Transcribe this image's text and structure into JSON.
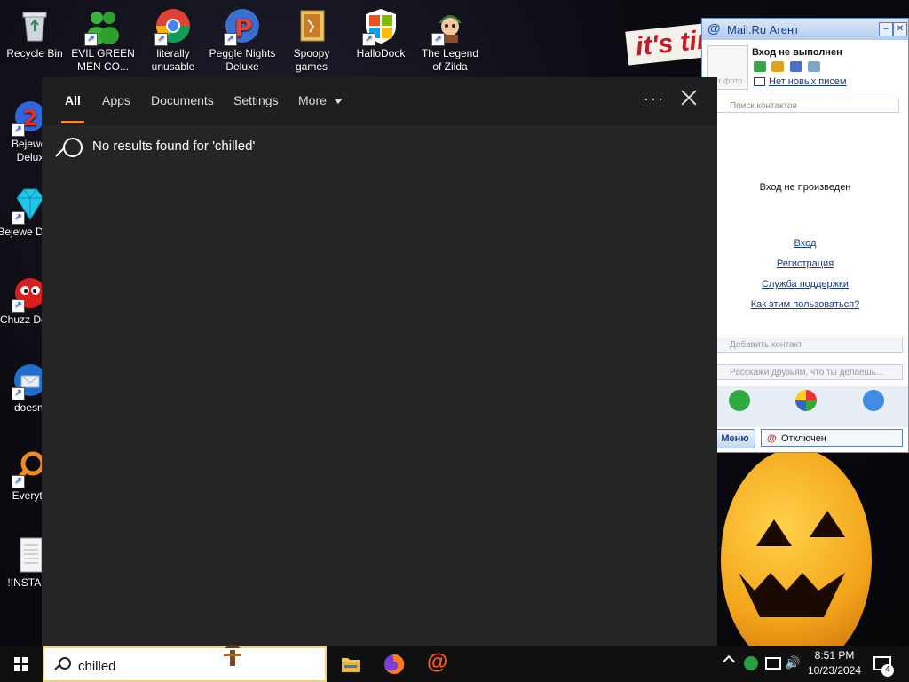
{
  "desktop": {
    "icons": [
      {
        "label": "Recycle Bin"
      },
      {
        "label": "EVIL GREEN MEN CO..."
      },
      {
        "label": "literally unusable"
      },
      {
        "label": "Peggle Nights Deluxe"
      },
      {
        "label": "Spoopy games"
      },
      {
        "label": "HalloDock"
      },
      {
        "label": "The Legend of Zilda"
      },
      {
        "label": "Bejewel Delux"
      },
      {
        "label": "Bejewe Delux"
      },
      {
        "label": "Chuzz Delux"
      },
      {
        "label": "doesnt"
      },
      {
        "label": "Everyth"
      },
      {
        "label": "!INSTALL"
      }
    ],
    "wallpaper_text": "it's tin"
  },
  "search_panel": {
    "tabs": [
      {
        "label": "All",
        "active": true
      },
      {
        "label": "Apps"
      },
      {
        "label": "Documents"
      },
      {
        "label": "Settings"
      },
      {
        "label": "More"
      }
    ],
    "ellipsis": "···",
    "no_results_message": "No results found for 'chilled'"
  },
  "mail_agent": {
    "title": "Mail.Ru Агент",
    "title_at": "@",
    "status": "Вход не выполнен",
    "photo_label": "ет фото",
    "no_new_letters": "Нет новых писем",
    "search_placeholder": "Поиск контактов",
    "not_logged_in": "Вход не произведен",
    "links": [
      "Вход",
      "Регистрация",
      "Служба поддержки",
      "Как этим пользоваться?"
    ],
    "add_contact": "Добавить контакт",
    "share_placeholder": "Расскажи друзьям, что ты делаешь...",
    "menu_label": "Меню",
    "connection_state": "Отключен"
  },
  "taskbar": {
    "search_value": "chilled",
    "clock_time": "8:51 PM",
    "clock_date": "10/23/2024",
    "notification_count": "4",
    "apps": [
      "file-explorer-icon",
      "firefox-icon",
      "mailru-agent-icon"
    ]
  }
}
